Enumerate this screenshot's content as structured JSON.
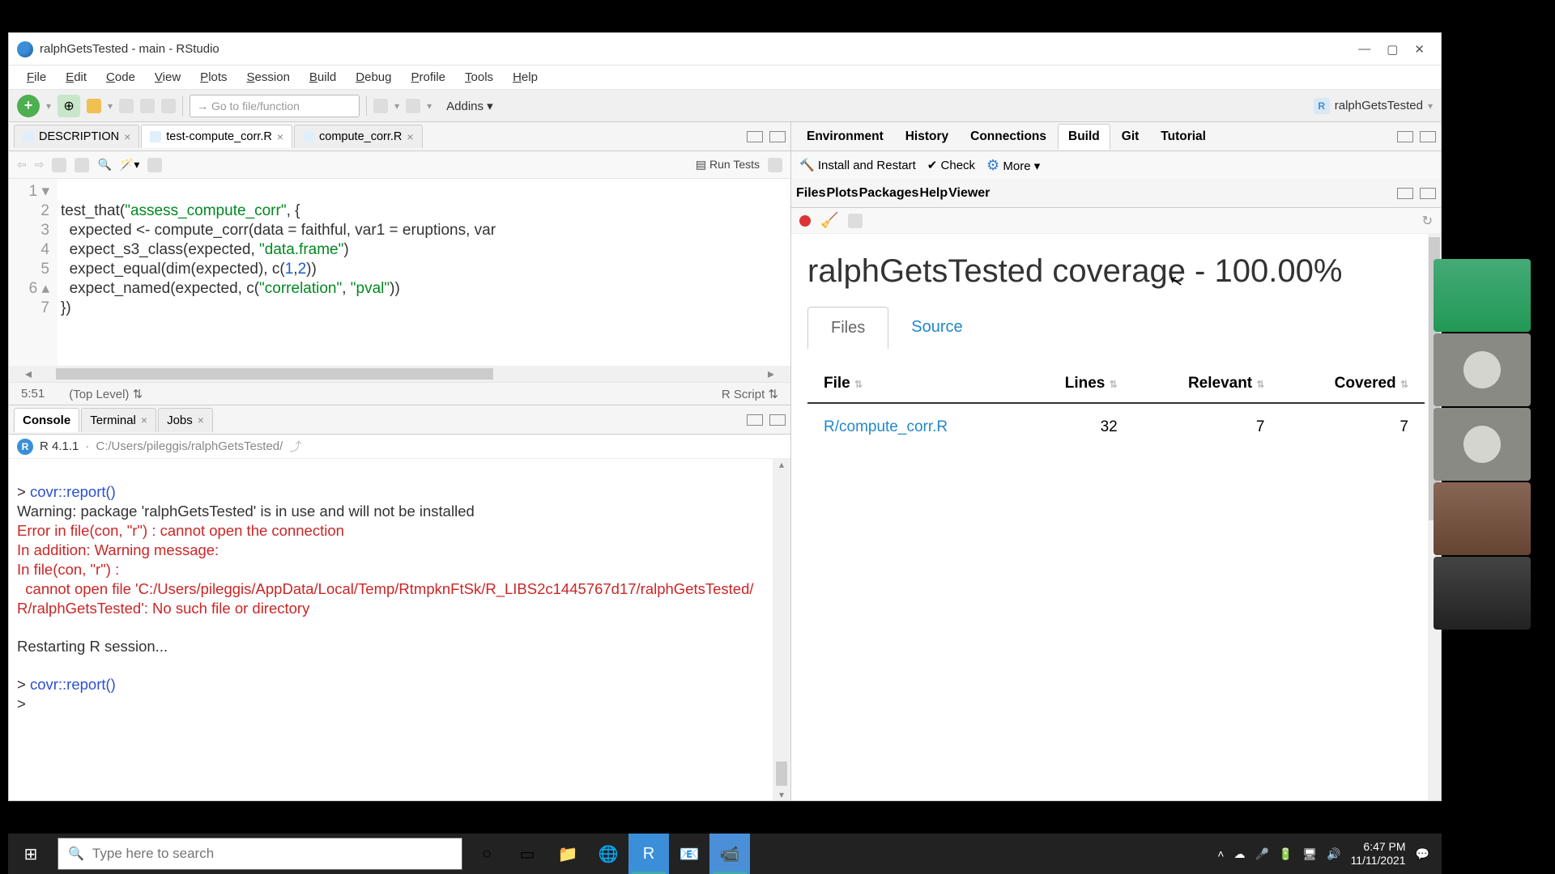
{
  "window": {
    "title": "ralphGetsTested - main - RStudio"
  },
  "menu": {
    "file": "File",
    "edit": "Edit",
    "code": "Code",
    "view": "View",
    "plots": "Plots",
    "session": "Session",
    "build": "Build",
    "debug": "Debug",
    "profile": "Profile",
    "tools": "Tools",
    "help": "Help"
  },
  "toolbar": {
    "search_placeholder": "Go to file/function",
    "addins": "Addins",
    "project": "ralphGetsTested"
  },
  "src_tabs": {
    "t1": "DESCRIPTION",
    "t2": "test-compute_corr.R",
    "t3": "compute_corr.R"
  },
  "src_toolbar": {
    "run": "Run Tests"
  },
  "code": {
    "l1a": "test_that",
    "l1b": "\"assess_compute_corr\"",
    "l2a": "expected <- compute_corr(data = faithful, var1 = eruptions, var",
    "l3a": "expect_s3_class(expected, ",
    "l3b": "\"data.frame\"",
    "l4a": "expect_equal(dim(expected), c(",
    "l4b": "1",
    "l4c": "2",
    "l5a": "expect_named(expected, c(",
    "l5b": "\"correlation\"",
    "l5c": "\"pval\"",
    "l6": "})"
  },
  "status": {
    "pos": "5:51",
    "scope": "(Top Level)",
    "type": "R Script"
  },
  "console_tabs": {
    "console": "Console",
    "terminal": "Terminal",
    "jobs": "Jobs"
  },
  "console_info": {
    "ver": "R 4.1.1",
    "path": "C:/Users/pileggis/ralphGetsTested/"
  },
  "console": {
    "l1": "> ",
    "l1c": "covr::report()",
    "l2": "Warning: package 'ralphGetsTested' is in use and will not be installed",
    "l3": "Error in file(con, \"r\") : cannot open the connection",
    "l4": "In addition: Warning message:",
    "l5": "In file(con, \"r\") :",
    "l6": "  cannot open file 'C:/Users/pileggis/AppData/Local/Temp/RtmpknFtSk/R_LIBS2c1445767d17/ralphGetsTested/R/ralphGetsTested': No such file or directory",
    "l7": "Restarting R session...",
    "l8": "> ",
    "l8c": "covr::report()",
    "l9": "> "
  },
  "env_tabs": {
    "env": "Environment",
    "hist": "History",
    "conn": "Connections",
    "build": "Build",
    "git": "Git",
    "tut": "Tutorial"
  },
  "env_toolbar": {
    "install": "Install and Restart",
    "check": "Check",
    "more": "More"
  },
  "view_tabs": {
    "files": "Files",
    "plots": "Plots",
    "packages": "Packages",
    "help": "Help",
    "viewer": "Viewer"
  },
  "coverage": {
    "title": "ralphGetsTested coverage - 100.00%",
    "tab_files": "Files",
    "tab_source": "Source",
    "col_file": "File",
    "col_lines": "Lines",
    "col_rel": "Relevant",
    "col_cov": "Covered",
    "row_file": "R/compute_corr.R",
    "row_lines": "32",
    "row_rel": "7",
    "row_cov": "7"
  },
  "taskbar": {
    "search_ph": "Type here to search",
    "time": "6:47 PM",
    "date": "11/11/2021"
  }
}
